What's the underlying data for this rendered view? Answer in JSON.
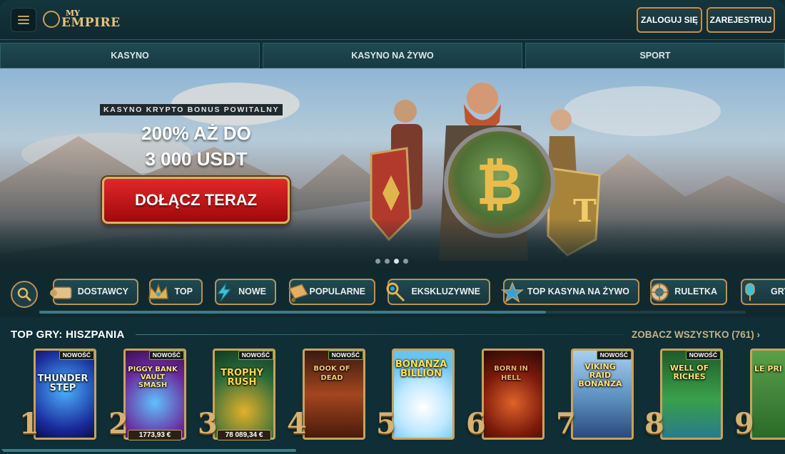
{
  "header": {
    "logo_line1": "MY",
    "logo_line2": "EMPIRE",
    "login_label": "ZALOGUJ SIĘ",
    "register_label": "ZAREJESTRUJ"
  },
  "nav": {
    "tabs": [
      "KASYNO",
      "KASYNO NA ŻYWO",
      "SPORT"
    ]
  },
  "hero": {
    "kicker": "KASYNO KRYPTO BONUS POWITALNY",
    "line1": "200% AŻ DO",
    "line2": "3 000 USDT",
    "cta_label": "DOŁĄCZ TERAZ",
    "slides": 4,
    "active_slide": 3
  },
  "categories": [
    {
      "label": "DOSTAWCY",
      "icon": "scroll-icon"
    },
    {
      "label": "TOP",
      "icon": "crown-icon"
    },
    {
      "label": "NOWE",
      "icon": "lightning-icon"
    },
    {
      "label": "POPULARNE",
      "icon": "horn-icon"
    },
    {
      "label": "EKSKLUZYWNE",
      "icon": "key-icon"
    },
    {
      "label": "TOP KASYNA NA ŻYWO",
      "icon": "star-icon"
    },
    {
      "label": "RULETKA",
      "icon": "roulette-icon"
    },
    {
      "label": "GRY S",
      "icon": "microphone-icon"
    }
  ],
  "games_section": {
    "title": "TOP GRY: HISZPANIA",
    "see_all": "ZOBACZ WSZYSTKO (761)",
    "badge_new": "NOWOŚĆ",
    "games": [
      {
        "rank": "1",
        "title": "THUNDER STEP",
        "new": true,
        "jackpot": ""
      },
      {
        "rank": "2",
        "title": "PIGGY BANK VAULT SMASH",
        "new": true,
        "jackpot": "1773,93 €"
      },
      {
        "rank": "3",
        "title": "TROPHY RUSH",
        "new": true,
        "jackpot": "78 089,34 €"
      },
      {
        "rank": "4",
        "title": "BOOK OF DEAD",
        "new": true,
        "jackpot": ""
      },
      {
        "rank": "5",
        "title": "BONANZA BILLION",
        "new": false,
        "jackpot": ""
      },
      {
        "rank": "6",
        "title": "BORN IN HELL",
        "new": false,
        "jackpot": ""
      },
      {
        "rank": "7",
        "title": "VIKING RAID BONANZA",
        "new": true,
        "jackpot": ""
      },
      {
        "rank": "8",
        "title": "WELL OF RICHES",
        "new": true,
        "jackpot": ""
      },
      {
        "rank": "9",
        "title": "LE PRI",
        "new": false,
        "jackpot": ""
      }
    ]
  }
}
